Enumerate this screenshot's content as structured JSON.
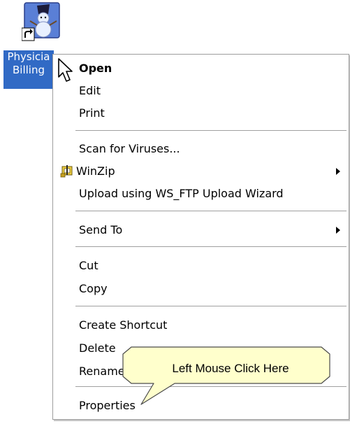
{
  "desktop": {
    "shortcut_label_line1": "Physicia",
    "shortcut_label_line2": "Billing",
    "shortcut_icon": "snowman-app-icon",
    "selection_color": "#316ac5"
  },
  "context_menu": {
    "items": [
      {
        "label": "Open"
      },
      {
        "label": "Edit"
      },
      {
        "label": "Print"
      },
      {
        "label": "Scan for Viruses..."
      },
      {
        "label": "WinZip"
      },
      {
        "label": "Upload using WS_FTP Upload Wizard"
      },
      {
        "label": "Send To"
      },
      {
        "label": "Cut"
      },
      {
        "label": "Copy"
      },
      {
        "label": "Create Shortcut"
      },
      {
        "label": "Delete"
      },
      {
        "label": "Rename"
      },
      {
        "label": "Properties"
      }
    ]
  },
  "callout": {
    "text": "Left Mouse Click Here",
    "fill_color": "#ffffcc"
  }
}
